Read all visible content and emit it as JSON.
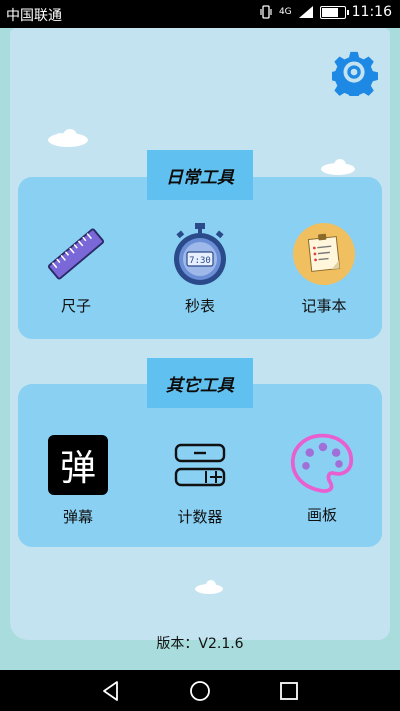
{
  "status": {
    "carrier": "中国联通",
    "network": "4G",
    "time": "11:16"
  },
  "settings_icon": "gear-icon",
  "sections": [
    {
      "title": "日常工具",
      "tools": [
        {
          "label": "尺子",
          "icon": "ruler-icon"
        },
        {
          "label": "秒表",
          "icon": "stopwatch-icon",
          "display": "7:30"
        },
        {
          "label": "记事本",
          "icon": "notepad-icon"
        }
      ]
    },
    {
      "title": "其它工具",
      "tools": [
        {
          "label": "弹幕",
          "icon": "danmaku-icon",
          "glyph": "弹"
        },
        {
          "label": "计数器",
          "icon": "counter-icon"
        },
        {
          "label": "画板",
          "icon": "palette-icon"
        }
      ]
    }
  ],
  "version": "版本：V2.1.6",
  "colors": {
    "background": "#a9dcdc",
    "paper": "#c3e3f0",
    "panel": "#89d0f3",
    "title_tab": "#60c1f0",
    "gear": "#1e88e5"
  }
}
